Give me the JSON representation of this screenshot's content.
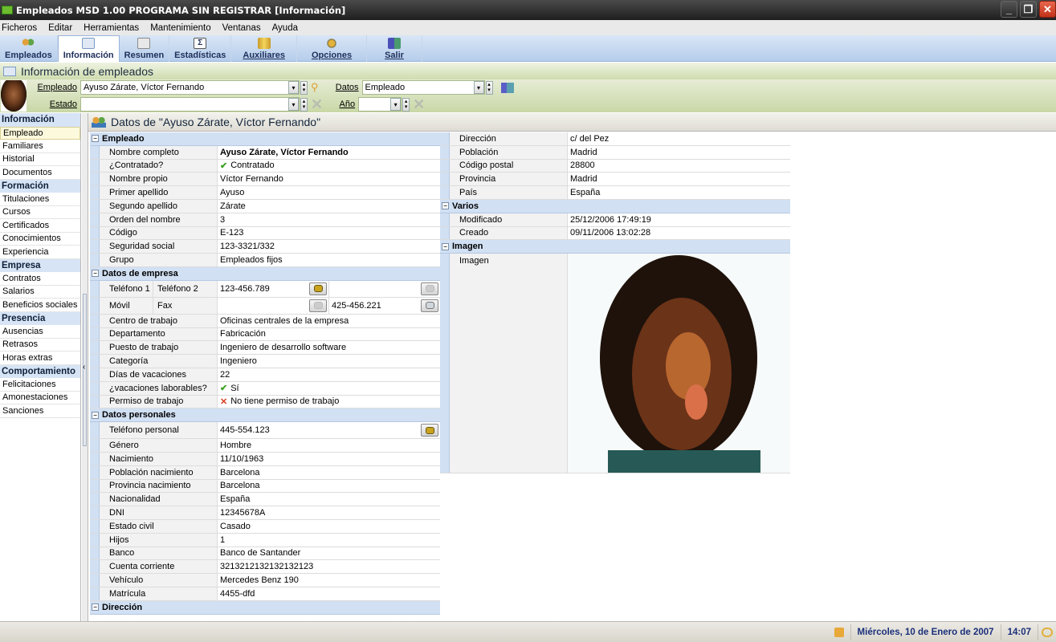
{
  "window": {
    "title": "Empleados MSD 1.00 PROGRAMA SIN REGISTRAR [Información]"
  },
  "menu": [
    "Ficheros",
    "Editar",
    "Herramientas",
    "Mantenimiento",
    "Ventanas",
    "Ayuda"
  ],
  "toolbar": [
    {
      "label": "Empleados",
      "icon": "people-icon",
      "active": false
    },
    {
      "label": "Información",
      "icon": "book-icon",
      "active": true
    },
    {
      "label": "Resumen",
      "icon": "calculator-icon",
      "active": false
    },
    {
      "label": "Estadísticas",
      "icon": "sigma-icon",
      "active": false
    },
    {
      "label": "Auxiliares",
      "icon": "database-icon",
      "active": false
    },
    {
      "label": "Opciones",
      "icon": "gears-icon",
      "active": false
    },
    {
      "label": "Salir",
      "icon": "exit-door-icon",
      "active": false
    }
  ],
  "module": {
    "title": "Información de empleados"
  },
  "filter": {
    "empleado_label": "Empleado",
    "empleado_value": "Ayuso Zárate, Víctor Fernando",
    "datos_label": "Datos",
    "datos_value": "Empleado",
    "estado_label": "Estado",
    "estado_value": "",
    "anio_label": "Año",
    "anio_value": ""
  },
  "nav": [
    {
      "section": "Información",
      "items": [
        "Empleado",
        "Familiares",
        "Historial",
        "Documentos"
      ]
    },
    {
      "section": "Formación",
      "items": [
        "Titulaciones",
        "Cursos",
        "Certificados",
        "Conocimientos",
        "Experiencia"
      ]
    },
    {
      "section": "Empresa",
      "items": [
        "Contratos",
        "Salarios",
        "Beneficios sociales"
      ]
    },
    {
      "section": "Presencia",
      "items": [
        "Ausencias",
        "Retrasos",
        "Horas extras"
      ]
    },
    {
      "section": "Comportamiento",
      "items": [
        "Felicitaciones",
        "Amonestaciones",
        "Sanciones"
      ]
    }
  ],
  "nav_selected": "Empleado",
  "main": {
    "header": "Datos de \"Ayuso Zárate, Víctor Fernando\"",
    "empleado": {
      "title": "Empleado",
      "rows": [
        {
          "k": "Nombre completo",
          "v": "Ayuso Zárate, Víctor Fernando",
          "bold": true
        },
        {
          "k": "¿Contratado?",
          "v": "Contratado",
          "icon": "check"
        },
        {
          "k": "Nombre propio",
          "v": "Víctor Fernando"
        },
        {
          "k": "Primer apellido",
          "v": "Ayuso"
        },
        {
          "k": "Segundo apellido",
          "v": "Zárate"
        },
        {
          "k": "Orden del nombre",
          "v": "3"
        },
        {
          "k": "Código",
          "v": "E-123"
        },
        {
          "k": "Seguridad social",
          "v": "123-3321/332"
        },
        {
          "k": "Grupo",
          "v": "Empleados fijos"
        }
      ]
    },
    "empresa": {
      "title": "Datos de empresa",
      "tel1_label": "Teléfono 1",
      "tel2_label": "Teléfono 2",
      "tel1_value": "123-456.789",
      "tel2_value": "",
      "movil_label": "Móvil",
      "fax_label": "Fax",
      "movil_value": "",
      "fax_value": "425-456.221",
      "rows": [
        {
          "k": "Centro de trabajo",
          "v": "Oficinas centrales de la empresa"
        },
        {
          "k": "Departamento",
          "v": "Fabricación"
        },
        {
          "k": "Puesto de trabajo",
          "v": "Ingeniero de desarrollo software"
        },
        {
          "k": "Categoría",
          "v": "Ingeniero"
        },
        {
          "k": "Días de vacaciones",
          "v": "22"
        },
        {
          "k": "¿vacaciones laborables?",
          "v": "Sí",
          "icon": "check"
        },
        {
          "k": "Permiso de trabajo",
          "v": "No tiene permiso de trabajo",
          "icon": "cross"
        }
      ]
    },
    "personales": {
      "title": "Datos personales",
      "tel_label": "Teléfono personal",
      "tel_value": "445-554.123",
      "rows": [
        {
          "k": "Género",
          "v": "Hombre"
        },
        {
          "k": "Nacimiento",
          "v": "11/10/1963"
        },
        {
          "k": "Población nacimiento",
          "v": "Barcelona"
        },
        {
          "k": "Provincia nacimiento",
          "v": "Barcelona"
        },
        {
          "k": "Nacionalidad",
          "v": "España"
        },
        {
          "k": "DNI",
          "v": "12345678A"
        },
        {
          "k": "Estado civil",
          "v": "Casado"
        },
        {
          "k": "Hijos",
          "v": "1"
        },
        {
          "k": "Banco",
          "v": "Banco de Santander"
        },
        {
          "k": "Cuenta corriente",
          "v": "3213212132132132123"
        },
        {
          "k": "Vehículo",
          "v": "Mercedes Benz 190"
        },
        {
          "k": "Matrícula",
          "v": "4455-dfd"
        }
      ]
    },
    "direccion_title": "Dirección",
    "direccion": [
      {
        "k": "Dirección",
        "v": "c/ del Pez"
      },
      {
        "k": "Población",
        "v": "Madrid"
      },
      {
        "k": "Código postal",
        "v": "28800"
      },
      {
        "k": "Provincia",
        "v": "Madrid"
      },
      {
        "k": "País",
        "v": "España"
      }
    ],
    "varios": {
      "title": "Varios",
      "rows": [
        {
          "k": "Modificado",
          "v": "25/12/2006 17:49:19"
        },
        {
          "k": "Creado",
          "v": "09/11/2006 13:02:28"
        }
      ]
    },
    "imagen": {
      "title": "Imagen",
      "label": "Imagen"
    }
  },
  "status": {
    "date": "Miércoles, 10 de Enero de 2007",
    "time": "14:07"
  }
}
